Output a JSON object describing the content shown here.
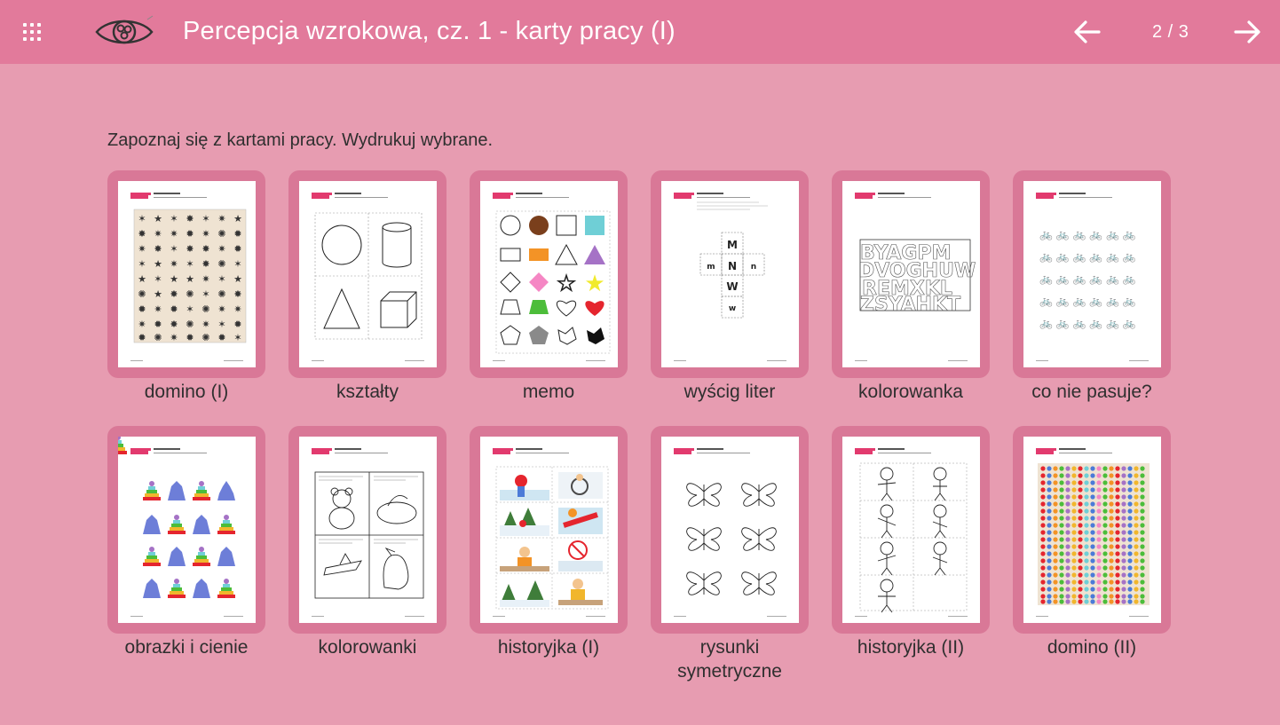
{
  "header": {
    "title": "Percepcja wzrokowa, cz. 1 - karty pracy (I)",
    "page_counter": "2 / 3",
    "menu_icon": "grid-menu-icon",
    "logo_icon": "eye-icon",
    "prev_icon": "arrow-left-icon",
    "next_icon": "arrow-right-icon",
    "bar_color": "#e27a9b",
    "background_color": "#e79cb1"
  },
  "main": {
    "instruction": "Zapoznaj się z kartami pracy. Wydrukuj wybrane.",
    "cards": [
      {
        "label": "domino (I)"
      },
      {
        "label": "kształty"
      },
      {
        "label": "memo"
      },
      {
        "label": "wyścig liter"
      },
      {
        "label": "kolorowanka"
      },
      {
        "label": "co nie pasuje?"
      },
      {
        "label": "obrazki i cienie"
      },
      {
        "label": "kolorowanki"
      },
      {
        "label": "historyjka (I)"
      },
      {
        "label": "rysunki symetryczne"
      },
      {
        "label": "historyjka (II)"
      },
      {
        "label": "domino (II)"
      }
    ]
  }
}
